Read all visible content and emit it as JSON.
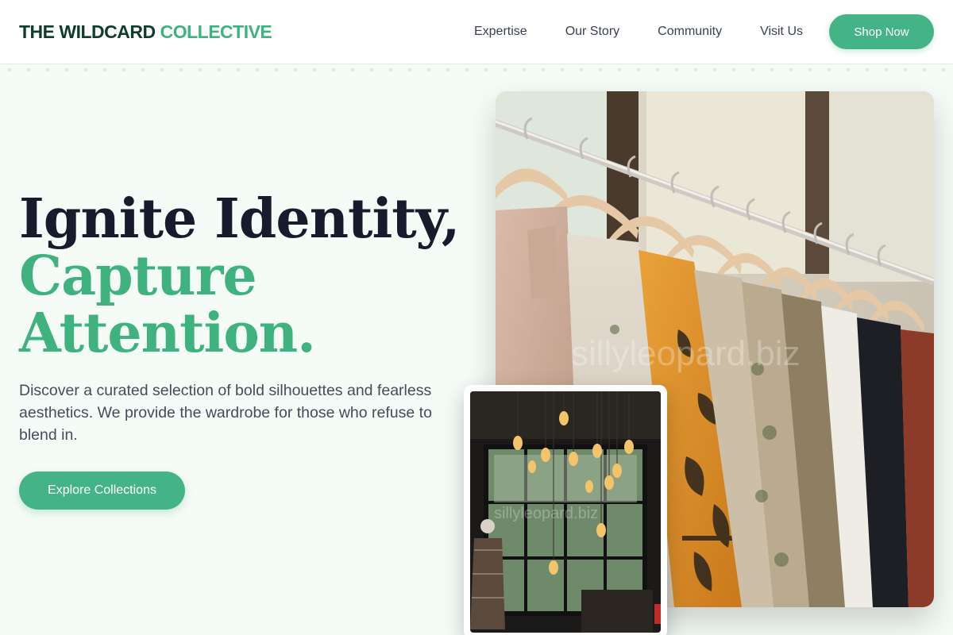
{
  "brand": {
    "part1": "THE WILDCARD",
    "part2": "COLLECTIVE"
  },
  "nav": {
    "items": [
      {
        "label": "Expertise"
      },
      {
        "label": "Our Story"
      },
      {
        "label": "Community"
      },
      {
        "label": "Visit Us"
      }
    ],
    "cta": "Shop Now"
  },
  "hero": {
    "line1": "Ignite Identity,",
    "line2": "Capture",
    "line3": "Attention.",
    "description": "Discover a curated selection of bold silhouettes and fearless aesthetics. We provide the wardrobe for those who refuse to blend in.",
    "cta": "Explore Collections"
  },
  "images": {
    "main_watermark": "sillyleopard.biz",
    "inset_watermark": "sillyleopard.biz"
  },
  "colors": {
    "accent": "#44b487",
    "dark": "#0f3d2c",
    "background": "#f5fbf7"
  }
}
